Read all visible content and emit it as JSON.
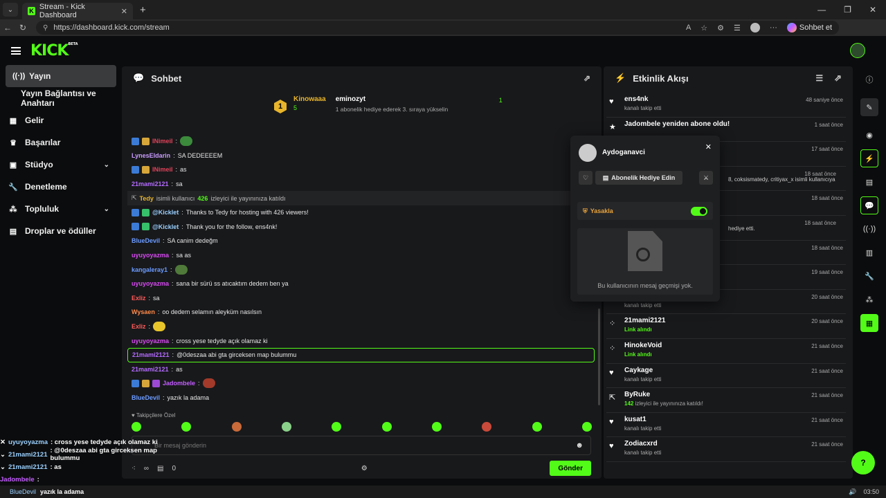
{
  "browser": {
    "tab_title": "Stream - Kick Dashboard",
    "url": "https://dashboard.kick.com/stream",
    "sohbet_et": "Sohbet et"
  },
  "brand": {
    "logo": "KICK",
    "beta": "BETA",
    "accent": "#53fc18"
  },
  "sidebar": {
    "items": [
      {
        "label": "Yayın",
        "icon": "broadcast-icon"
      },
      {
        "label": "Yayın Bağlantısı ve Anahtarı"
      },
      {
        "label": "Gelir",
        "icon": "revenue-icon"
      },
      {
        "label": "Başarılar",
        "icon": "trophy-icon"
      },
      {
        "label": "Stüdyo",
        "icon": "studio-icon"
      },
      {
        "label": "Denetleme",
        "icon": "wrench-icon"
      },
      {
        "label": "Topluluk",
        "icon": "community-icon"
      },
      {
        "label": "Droplar ve ödüller",
        "icon": "gift-icon"
      }
    ]
  },
  "chat": {
    "title": "Sohbet",
    "pinned": {
      "rank": "1",
      "top_user": "Kinowaaa",
      "top_count": "5",
      "gifter": "eminozyt",
      "gifter_count": "1",
      "gifter_msg": "1 abonelik hediye ederek 3. sıraya yükselin"
    },
    "messages": [
      {
        "user": "INimeil",
        "text": "",
        "color": "#e0435a",
        "emote": true
      },
      {
        "user": "LynesEldarin",
        "text": "SA DEDEEEEM",
        "color": "#c99cff"
      },
      {
        "user": "INimeil",
        "text": "as",
        "color": "#e0435a"
      },
      {
        "user": "21mami2121",
        "text": "sa",
        "color": "#b46bff"
      },
      {
        "system": true,
        "user": "Tedy",
        "pre": "isimli kullanıcı",
        "count": "426",
        "text": "izleyici ile yayınınıza katıldı"
      },
      {
        "user": "@Kicklet",
        "text": "Thanks to Tedy for hosting with 426 viewers!",
        "color": "#9ad0ff"
      },
      {
        "user": "@Kicklet",
        "text": "Thank you for the follow, ens4nk!",
        "color": "#9ad0ff"
      },
      {
        "user": "BlueDevil",
        "text": "SA canim dedeğm",
        "color": "#6b9bff"
      },
      {
        "user": "uyuyoyazma",
        "text": "sa as",
        "color": "#d64af0"
      },
      {
        "user": "kangaleray1",
        "text": "",
        "color": "#6b9bff",
        "emote": true
      },
      {
        "user": "uyuyoyazma",
        "text": "sana bir sürü ss atıcaktım dedem ben ya",
        "color": "#d64af0"
      },
      {
        "user": "Exliz",
        "text": "sa",
        "color": "#ff5a5a"
      },
      {
        "user": "Wysaen",
        "text": "oo dedem selamın aleyküm nasılsın",
        "color": "#ff8a4a"
      },
      {
        "user": "Exliz",
        "text": "",
        "color": "#ff5a5a",
        "emote": true
      },
      {
        "user": "uyuyoyazma",
        "text": "cross yese tedyde açık olamaz ki",
        "color": "#d64af0"
      },
      {
        "user": "21mami2121",
        "text": "@0deszaa abi gta girceksen map bulummu",
        "color": "#b46bff",
        "highlight": true
      },
      {
        "user": "21mami2121",
        "text": "as",
        "color": "#b46bff"
      },
      {
        "user": "Jadombele",
        "text": "",
        "color": "#c35cff",
        "emote": true
      },
      {
        "user": "BlueDevil",
        "text": "yazık la adama",
        "color": "#6b9bff"
      }
    ],
    "followers_only": "Takipçilere Özel",
    "input_placeholder": "Bir mesaj gönderin",
    "viewers": "∞",
    "gifts": "0",
    "send": "Gönder"
  },
  "activity": {
    "title": "Etkinlik Akışı",
    "items": [
      {
        "user": "ens4nk",
        "desc": "kanalı takip etti",
        "time": "48 saniye önce",
        "icon": "heart-icon"
      },
      {
        "user": "Jadombele yeniden abone oldu!",
        "desc": "",
        "time": "1 saat önce",
        "icon": "star-icon"
      },
      {
        "user": "",
        "desc": "",
        "time": "17 saat önce",
        "icon": "star-icon"
      },
      {
        "user": "",
        "desc": "8, coksismatedy, critiyax_x isimli kullanıcıya",
        "time": "18 saat önce",
        "icon": "gift-icon"
      },
      {
        "user": "",
        "desc": "",
        "time": "18 saat önce",
        "icon": "heart-icon"
      },
      {
        "user": "",
        "desc": "hediye etti.",
        "time": "18 saat önce",
        "icon": "gift-icon"
      },
      {
        "user": "",
        "desc": "",
        "time": "18 saat önce",
        "icon": "heart-icon"
      },
      {
        "user": "",
        "desc": "",
        "time": "19 saat önce",
        "icon": "heart-icon"
      },
      {
        "user": "",
        "desc": "kanalı takip etti",
        "time": "20 saat önce",
        "icon": "heart-icon"
      },
      {
        "user": "21mami2121",
        "desc": "Link alındı",
        "time": "20 saat önce",
        "icon": "link-icon"
      },
      {
        "user": "HinokeVoid",
        "desc": "Link alındı",
        "time": "21 saat önce",
        "icon": "link-icon"
      },
      {
        "user": "Caykage",
        "desc": "kanalı takip etti",
        "time": "21 saat önce",
        "icon": "heart-icon"
      },
      {
        "user": "ByRuke",
        "desc_count": "142",
        "desc": "izleyici ile yayınınıza katıldı!",
        "time": "21 saat önce",
        "icon": "host-icon"
      },
      {
        "user": "kusat1",
        "desc": "kanalı takip etti",
        "time": "21 saat önce",
        "icon": "heart-icon"
      },
      {
        "user": "Zodiacxrd",
        "desc": "kanalı takip etti",
        "time": "21 saat önce",
        "icon": "heart-icon"
      }
    ]
  },
  "popup": {
    "username": "Aydoganavci",
    "gift_sub": "Abonelik Hediye Edin",
    "ban": "Yasakla",
    "no_history": "Bu kullanıcının mesaj geçmişi yok."
  },
  "overlay": [
    {
      "user": "uyuyoyazma",
      "text": ": cross yese tedyde açık olamaz ki"
    },
    {
      "user": "21mami2121",
      "text": ": @0deszaa abi gta girceksen map bulummu"
    },
    {
      "user": "21mami2121",
      "text": ": as"
    },
    {
      "user": "Jadombele",
      "text": ":"
    },
    {
      "user": "BlueDevil",
      "text": "yazık la adama"
    }
  ],
  "taskbar": {
    "time": "03:50"
  }
}
